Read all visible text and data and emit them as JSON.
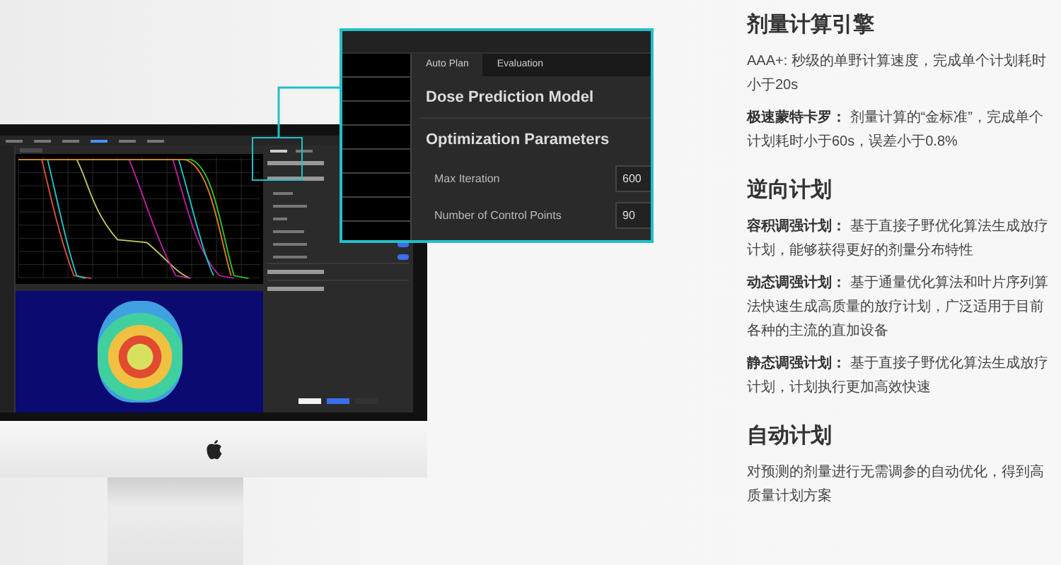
{
  "monitor": {
    "toggles": [
      {
        "on": true
      },
      {
        "on": true
      }
    ]
  },
  "callout": {
    "tabs": [
      {
        "label": "Auto Plan",
        "selected": true
      },
      {
        "label": "Evaluation",
        "selected": false
      }
    ],
    "model_title": "Dose Prediction Model",
    "params_title": "Optimization Parameters",
    "params": [
      {
        "label": "Max Iteration",
        "value": "600"
      },
      {
        "label": "Number of Control Points",
        "value": "90"
      }
    ]
  },
  "sections": [
    {
      "heading": "剂量计算引擎",
      "paragraphs": [
        "AAA+: 秒级的单野计算速度，完成单个计划耗时小于20s",
        "**极速蒙特卡罗：** 剂量计算的“金标准”，完成单个计划耗时小于60s，误差小于0.8%"
      ]
    },
    {
      "heading": "逆向计划",
      "paragraphs": [
        "**容积调强计划：** 基于直接子野优化算法生成放疗计划，能够获得更好的剂量分布特性",
        "**动态调强计划：** 基于通量优化算法和叶片序列算法快速生成高质量的放疗计划，广泛适用于目前各种的主流的直加设备",
        "**静态调强计划：** 基于直接子野优化算法生成放疗计划，计划执行更加高效快速"
      ]
    },
    {
      "heading": "自动计划",
      "paragraphs": [
        "对预测的剂量进行无需调参的自动优化，得到高质量计划方案"
      ]
    }
  ]
}
